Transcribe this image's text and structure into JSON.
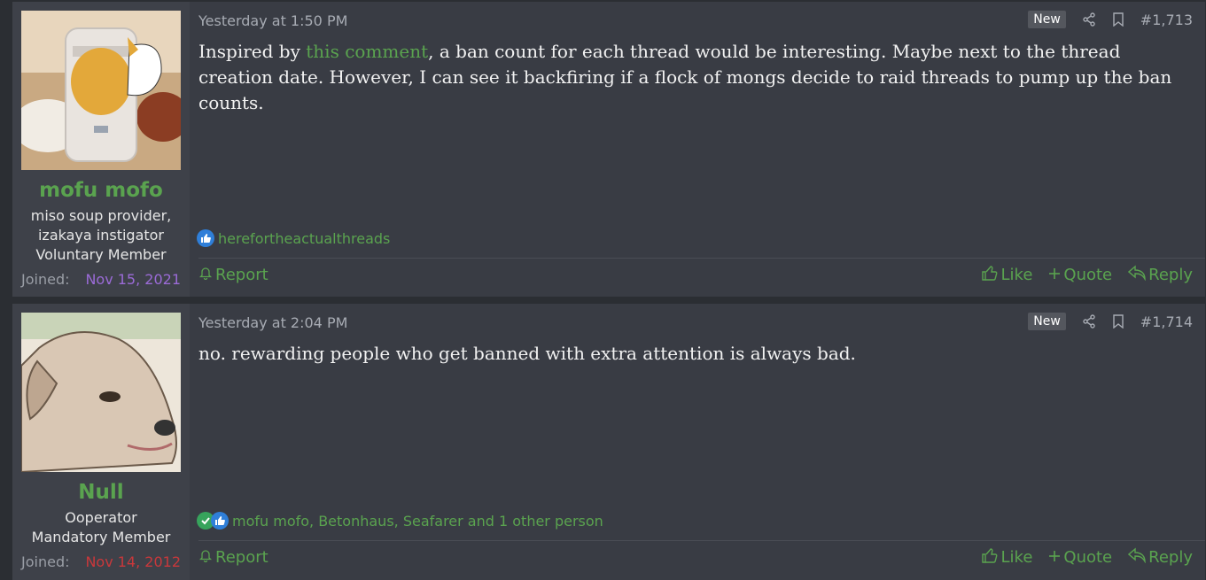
{
  "posts": [
    {
      "author": {
        "name": "mofu mofo",
        "title_lines": [
          "miso soup provider,",
          "izakaya instigator",
          "Voluntary Member"
        ],
        "joined_label": "Joined:",
        "joined_date": "Nov 15, 2021",
        "avatar_icon": "rice-cooker-fox-avatar"
      },
      "date": "Yesterday at 1:50 PM",
      "badge": "New",
      "number": "#1,713",
      "body_pre": "Inspired by ",
      "body_link": "this comment",
      "body_post": ", a ban count for each thread would be interesting. Maybe next to the thread creation date. However, I can see it backfiring if a flock of mongs decide to raid threads to pump up the ban counts.",
      "reactions_text": "herefortheactualthreads",
      "report_label": "Report",
      "like_label": "Like",
      "quote_label": "Quote",
      "reply_label": "Reply"
    },
    {
      "author": {
        "name": "Null",
        "title_lines": [
          "Ooperator",
          "Mandatory Member"
        ],
        "joined_label": "Joined:",
        "joined_date": "Nov 14, 2012",
        "avatar_icon": "dog-avatar"
      },
      "date": "Yesterday at 2:04 PM",
      "badge": "New",
      "number": "#1,714",
      "body": "no. rewarding people who get banned with extra attention is always bad.",
      "reactions_text": "mofu mofo, Betonhaus, Seafarer and 1 other person",
      "report_label": "Report",
      "like_label": "Like",
      "quote_label": "Quote",
      "reply_label": "Reply"
    }
  ],
  "colors": {
    "accent": "#5aa34f",
    "post_bg": "#393c44",
    "user_bg": "#3e4149",
    "joined_purple": "#9b6bd7",
    "joined_red": "#c9383b"
  }
}
